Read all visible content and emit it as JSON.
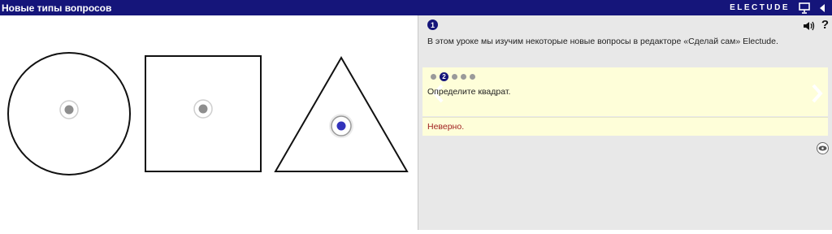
{
  "header": {
    "title": "Новые типы вопросов",
    "logo_text": "ELECTUDE",
    "icons": [
      "presentation-icon",
      "back-arrow-icon"
    ]
  },
  "canvas": {
    "shapes": [
      "circle",
      "square",
      "triangle"
    ],
    "hotspots": [
      {
        "shape": "circle",
        "state": "inactive"
      },
      {
        "shape": "square",
        "state": "inactive"
      },
      {
        "shape": "triangle",
        "state": "selected"
      }
    ]
  },
  "panel": {
    "step_number": "1",
    "intro_text": "В этом уроке мы изучим некоторые новые вопросы в редакторе «Сделай сам» Electude.",
    "help_label": "?",
    "question": {
      "current_page": "2",
      "page_count": 5,
      "prompt": "Определите квадрат."
    },
    "feedback": "Неверно."
  },
  "colors": {
    "header_bg": "#15157a",
    "panel_bg": "#e8e8e8",
    "question_bg": "#fefed9",
    "feedback_text": "#a02020",
    "selected_hotspot": "#3333bb"
  }
}
